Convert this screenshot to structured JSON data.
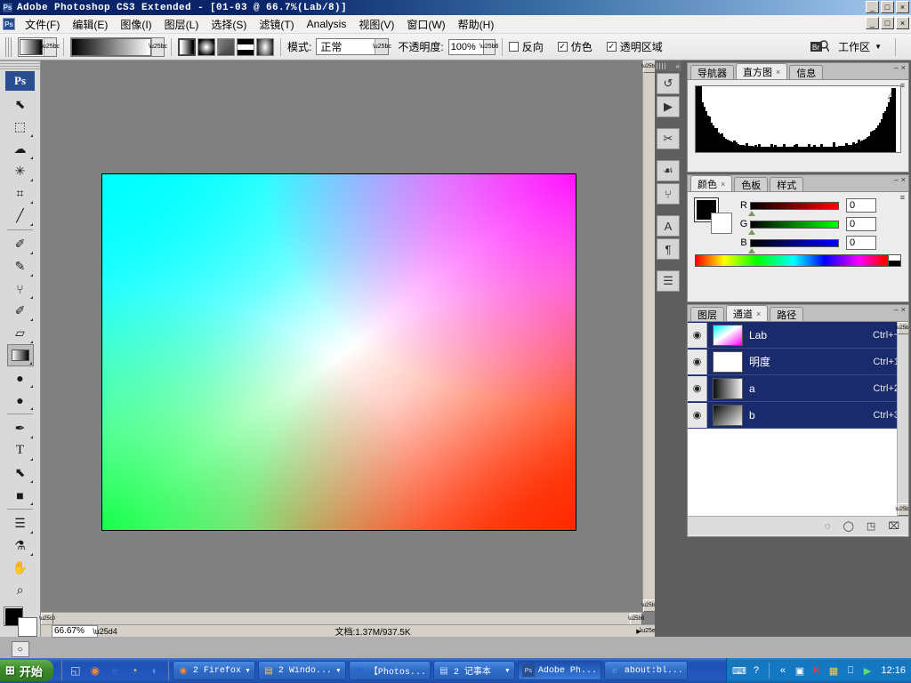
{
  "app": {
    "title": "Adobe Photoshop CS3 Extended - [01-03 @ 66.7%(Lab/8)]",
    "logo_text": "Ps"
  },
  "titlebar": {
    "minimize": "_",
    "restore": "□",
    "close": "×"
  },
  "menubar": {
    "items": [
      {
        "label": "文件(F)"
      },
      {
        "label": "编辑(E)"
      },
      {
        "label": "图像(I)"
      },
      {
        "label": "图层(L)"
      },
      {
        "label": "选择(S)"
      },
      {
        "label": "滤镜(T)"
      },
      {
        "label": "Analysis"
      },
      {
        "label": "视图(V)"
      },
      {
        "label": "窗口(W)"
      },
      {
        "label": "帮助(H)"
      }
    ],
    "minimize": "_",
    "restore": "□",
    "close": "×"
  },
  "options": {
    "tool_preset_label": "gradient-preset",
    "gradient_picker_label": "gradient-picker",
    "gradient_types": [
      {
        "name": "linear-gradient-type",
        "selected": true
      },
      {
        "name": "radial-gradient-type",
        "selected": false
      },
      {
        "name": "angle-gradient-type",
        "selected": false
      },
      {
        "name": "reflected-gradient-type",
        "selected": false
      },
      {
        "name": "diamond-gradient-type",
        "selected": false
      }
    ],
    "mode_label": "模式:",
    "mode_value": "正常",
    "opacity_label": "不透明度:",
    "opacity_value": "100%",
    "checkboxes": [
      {
        "label": "反向",
        "checked": false,
        "mark": ""
      },
      {
        "label": "仿色",
        "checked": true,
        "mark": "✓"
      },
      {
        "label": "透明区域",
        "checked": true,
        "mark": "✓"
      }
    ],
    "bridge_label": "Br",
    "workspace_label": "工作区",
    "workspace_caret": "▼"
  },
  "toolbox": {
    "logo": "Ps",
    "tools": [
      {
        "name": "move-tool",
        "glyph": "⬉",
        "has_submenu": false,
        "active": false
      },
      {
        "name": "marquee-tool",
        "glyph": "⬚",
        "has_submenu": true,
        "active": false
      },
      {
        "name": "lasso-tool",
        "glyph": "☁",
        "has_submenu": true,
        "active": false
      },
      {
        "name": "magic-wand-tool",
        "glyph": "✳",
        "has_submenu": true,
        "active": false
      },
      {
        "name": "crop-tool",
        "glyph": "⌗",
        "has_submenu": true,
        "active": false
      },
      {
        "name": "slice-tool",
        "glyph": "╱",
        "has_submenu": true,
        "active": false
      },
      {
        "name": "healing-brush-tool",
        "glyph": "✐",
        "has_submenu": true,
        "active": false
      },
      {
        "name": "brush-tool",
        "glyph": "✎",
        "has_submenu": true,
        "active": false
      },
      {
        "name": "clone-stamp-tool",
        "glyph": "⑂",
        "has_submenu": true,
        "active": false
      },
      {
        "name": "history-brush-tool",
        "glyph": "✐",
        "has_submenu": true,
        "active": false
      },
      {
        "name": "eraser-tool",
        "glyph": "▱",
        "has_submenu": true,
        "active": false
      },
      {
        "name": "gradient-tool",
        "glyph": "■",
        "has_submenu": true,
        "active": true
      },
      {
        "name": "blur-tool",
        "glyph": "●",
        "has_submenu": true,
        "active": false
      },
      {
        "name": "dodge-tool",
        "glyph": "●",
        "has_submenu": true,
        "active": false
      },
      {
        "name": "pen-tool",
        "glyph": "✒",
        "has_submenu": true,
        "active": false
      },
      {
        "name": "type-tool",
        "glyph": "T",
        "has_submenu": true,
        "active": false
      },
      {
        "name": "path-selection-tool",
        "glyph": "⬉",
        "has_submenu": true,
        "active": false
      },
      {
        "name": "shape-tool",
        "glyph": "■",
        "has_submenu": true,
        "active": false
      },
      {
        "name": "notes-tool",
        "glyph": "☰",
        "has_submenu": true,
        "active": false
      },
      {
        "name": "eyedropper-tool",
        "glyph": "⚗",
        "has_submenu": true,
        "active": false
      },
      {
        "name": "hand-tool",
        "glyph": "✋",
        "has_submenu": false,
        "active": false
      },
      {
        "name": "zoom-tool",
        "glyph": "⌕",
        "has_submenu": false,
        "active": false
      }
    ],
    "foreground_color": "#000000",
    "background_color": "#ffffff",
    "swap_glyph": "↰",
    "default_glyph": "◰",
    "quickmask": [
      {
        "name": "standard-mode-button",
        "glyph": "○",
        "on": true
      },
      {
        "name": "quickmask-mode-button",
        "glyph": "◑",
        "on": false
      }
    ],
    "screenmode": [
      {
        "name": "screen-mode-button",
        "glyph": "□",
        "on": true
      }
    ]
  },
  "document": {
    "zoom": "66.67%",
    "doc_info": "文档:1.37M/937.5K",
    "scroll_arrow": "▶",
    "resize_handle": "◢"
  },
  "icon_dock": {
    "collapse_glyph": "«",
    "icons": [
      {
        "name": "history-panel-icon",
        "glyph": "↺"
      },
      {
        "name": "actions-panel-icon",
        "glyph": "▶"
      },
      {
        "name": "tool-presets-panel-icon",
        "glyph": "✂"
      },
      {
        "name": "brushes-panel-icon",
        "glyph": "☙"
      },
      {
        "name": "clone-source-panel-icon",
        "glyph": "⑂"
      },
      {
        "name": "character-panel-icon",
        "glyph": "A"
      },
      {
        "name": "paragraph-panel-icon",
        "glyph": "¶"
      },
      {
        "name": "layer-comps-panel-icon",
        "glyph": "☰"
      }
    ]
  },
  "histogram_panel": {
    "tabs": [
      {
        "label": "导航器",
        "active": false,
        "closable": false
      },
      {
        "label": "直方图",
        "active": true,
        "closable": true
      },
      {
        "label": "信息",
        "active": false,
        "closable": false
      }
    ],
    "warning_glyph": "⚠",
    "menu_glyph": "≡",
    "minimize": "–",
    "close": "×"
  },
  "color_panel": {
    "tabs": [
      {
        "label": "颜色",
        "active": true,
        "closable": true
      },
      {
        "label": "色板",
        "active": false,
        "closable": false
      },
      {
        "label": "样式",
        "active": false,
        "closable": false
      }
    ],
    "foreground_color": "#000000",
    "background_color": "#ffffff",
    "sliders": [
      {
        "label": "R",
        "value": "0"
      },
      {
        "label": "G",
        "value": "0"
      },
      {
        "label": "B",
        "value": "0"
      }
    ],
    "menu_glyph": "≡",
    "minimize": "–",
    "close": "×"
  },
  "channels_panel": {
    "tabs": [
      {
        "label": "图层",
        "active": false,
        "closable": false
      },
      {
        "label": "通道",
        "active": true,
        "closable": true
      },
      {
        "label": "路径",
        "active": false,
        "closable": false
      }
    ],
    "eye_glyph": "◉",
    "rows": [
      {
        "name": "Lab",
        "shortcut": "Ctrl+~",
        "thumb": "th-lab",
        "visible": true
      },
      {
        "name": "明度",
        "shortcut": "Ctrl+1",
        "thumb": "th-white",
        "visible": true
      },
      {
        "name": "a",
        "shortcut": "Ctrl+2",
        "thumb": "th-a",
        "visible": true
      },
      {
        "name": "b",
        "shortcut": "Ctrl+3",
        "thumb": "th-b",
        "visible": true
      }
    ],
    "bottom_buttons": [
      {
        "name": "load-channel-as-selection-button",
        "glyph": "◌"
      },
      {
        "name": "save-selection-as-channel-button",
        "glyph": "◯"
      },
      {
        "name": "new-channel-button",
        "glyph": "◳"
      },
      {
        "name": "delete-channel-button",
        "glyph": "⌧"
      }
    ],
    "menu_glyph": "≡",
    "minimize": "–",
    "close": "×"
  },
  "taskbar": {
    "start_label": "开始",
    "start_glyph": "⊞",
    "quicklaunch": [
      {
        "name": "show-desktop-icon",
        "glyph": "◱"
      },
      {
        "name": "firefox-icon",
        "glyph": "◉"
      },
      {
        "name": "internet-explorer-icon",
        "glyph": "e"
      },
      {
        "name": "clock-icon",
        "glyph": "◔"
      },
      {
        "name": "media-icon",
        "glyph": "◖"
      }
    ],
    "tasks": [
      {
        "label": "2 Firefox",
        "icon": "◉",
        "caret": "▼",
        "active": false
      },
      {
        "label": "2 Windo...",
        "icon": "▤",
        "caret": "▼",
        "active": false
      },
      {
        "label": "【Photos...",
        "icon": "W",
        "caret": "",
        "active": false
      },
      {
        "label": "2 记事本",
        "icon": "▤",
        "caret": "▼",
        "active": false
      },
      {
        "label": "Adobe Ph...",
        "icon": "Ps",
        "caret": "",
        "active": true
      },
      {
        "label": "about:bl...",
        "icon": "e",
        "caret": "",
        "active": false
      }
    ],
    "tray": [
      {
        "name": "keyboard-layout-icon",
        "glyph": "⌨"
      },
      {
        "name": "help-icon",
        "glyph": "?"
      },
      {
        "name": "expand-tray-icon",
        "glyph": "«"
      },
      {
        "name": "network-icon",
        "glyph": "▣"
      },
      {
        "name": "kaspersky-icon",
        "glyph": "K"
      },
      {
        "name": "monitor-icon",
        "glyph": "▦"
      },
      {
        "name": "network-connection-icon",
        "glyph": "⎕"
      },
      {
        "name": "volume-icon",
        "glyph": "▶"
      }
    ],
    "clock": "12:16"
  }
}
